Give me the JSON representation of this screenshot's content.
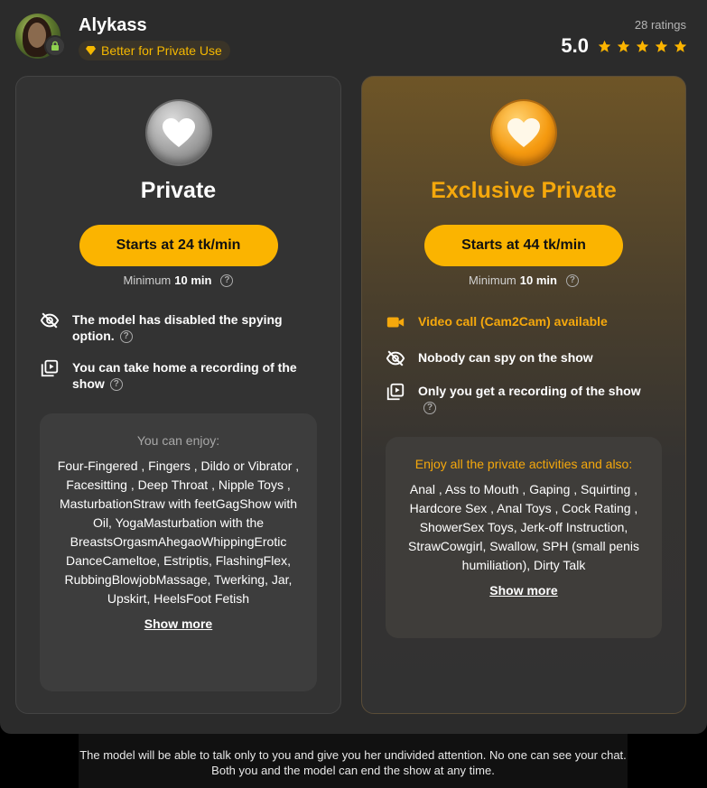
{
  "header": {
    "model_name": "Alykass",
    "badge_label": "Better for Private Use",
    "ratings_count": "28 ratings",
    "rating_value": "5.0",
    "stars": 5
  },
  "cards": {
    "private": {
      "title": "Private",
      "start_button": "Starts at 24 tk/min",
      "minimum_label": "Minimum",
      "minimum_value": "10 min",
      "features": [
        {
          "icon": "eye-off-icon",
          "text": "The model has disabled the spying option."
        },
        {
          "icon": "recording-icon",
          "text": "You can take home a recording of the show"
        }
      ],
      "enjoy_title": "You can enjoy:",
      "enjoy_list": "Four-Fingered , Fingers , Dildo or Vibrator , Facesitting , Deep Throat , Nipple Toys , MasturbationStraw with feetGagShow with Oil, YogaMasturbation with the BreastsOrgasmAhegaoWhippingErotic DanceCameltoe, Estriptis, FlashingFlex, RubbingBlowjobMassage, Twerking, Jar, Upskirt, HeelsFoot Fetish",
      "show_more": "Show more"
    },
    "exclusive": {
      "title": "Exclusive Private",
      "start_button": "Starts at 44 tk/min",
      "minimum_label": "Minimum",
      "minimum_value": "10 min",
      "features": [
        {
          "icon": "video-camera-icon",
          "text": "Video call (Cam2Cam) available"
        },
        {
          "icon": "eye-off-icon",
          "text": "Nobody can spy on the show"
        },
        {
          "icon": "recording-icon",
          "text": "Only you get a recording of the show"
        }
      ],
      "enjoy_title": "Enjoy all the private activities and also:",
      "enjoy_list": "Anal , Ass to Mouth , Gaping , Squirting , Hardcore Sex , Anal Toys , Cock Rating , ShowerSex Toys, Jerk-off Instruction, StrawCowgirl, Swallow, SPH (small penis humiliation), Dirty Talk",
      "show_more": "Show more"
    }
  },
  "footer": {
    "note": "The model will be able to talk only to you and give you her undivided attention. No one can see your chat. Both you and the model can end the show at any time."
  },
  "colors": {
    "accent": "#fbb400",
    "gold_text": "#f5a80c",
    "background": "#2b2b2b"
  }
}
